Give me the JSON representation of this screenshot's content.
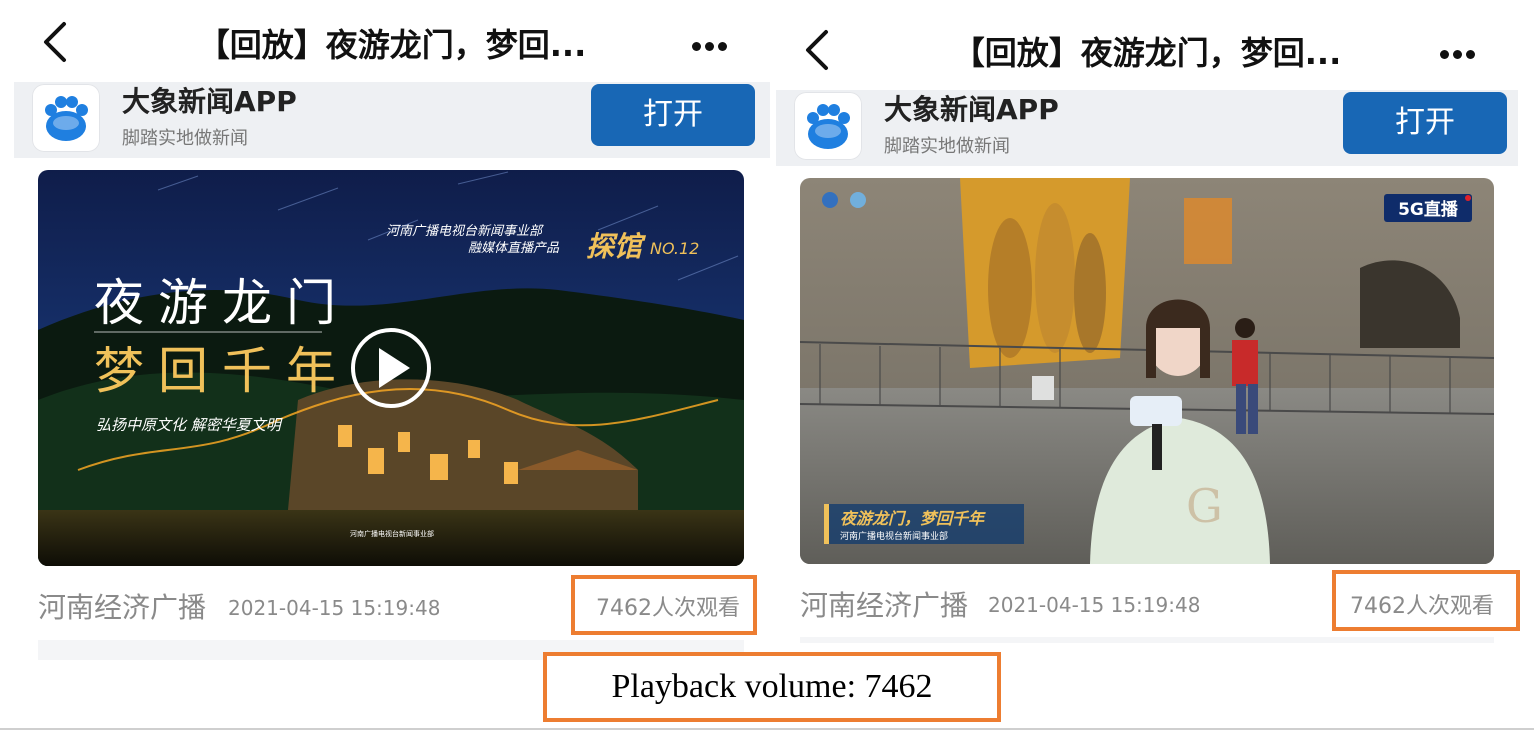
{
  "screens": [
    {
      "title": "【回放】夜游龙门，梦回...",
      "app": {
        "name": "大象新闻APP",
        "slogan": "脚踏实地做新闻",
        "open_label": "打开"
      },
      "video": {
        "overlay_org": "河南广播电视台新闻事业部",
        "overlay_product": "融媒体直播产品",
        "overlay_brand": "探馆",
        "overlay_issue": "NO.12",
        "headline_1": "夜游龙门",
        "headline_2": "梦回千年",
        "tagline": "弘扬中原文化  解密华夏文明",
        "footer_note": "河南广播电视台新闻事业部"
      },
      "channel": "河南经济广播",
      "timestamp": "2021-04-15 15:19:48",
      "views": "7462人次观看"
    },
    {
      "title": "【回放】夜游龙门，梦回...",
      "app": {
        "name": "大象新闻APP",
        "slogan": "脚踏实地做新闻",
        "open_label": "打开"
      },
      "video": {
        "live_badge": "5G直播",
        "lower_third_title": "夜游龙门，梦回千年",
        "lower_third_sub": "河南广播电视台新闻事业部"
      },
      "channel": "河南经济广播",
      "timestamp": "2021-04-15 15:19:48",
      "views": "7462人次观看"
    }
  ],
  "caption": "Playback volume: 7462",
  "colors": {
    "accent_blue": "#1867b5",
    "highlight_orange": "#ed7d31",
    "banner_gray": "#eef0f3"
  },
  "icons": {
    "back": "chevron-left-icon",
    "more": "ellipsis-icon",
    "logo": "elephant-paw-icon",
    "play": "play-icon"
  }
}
